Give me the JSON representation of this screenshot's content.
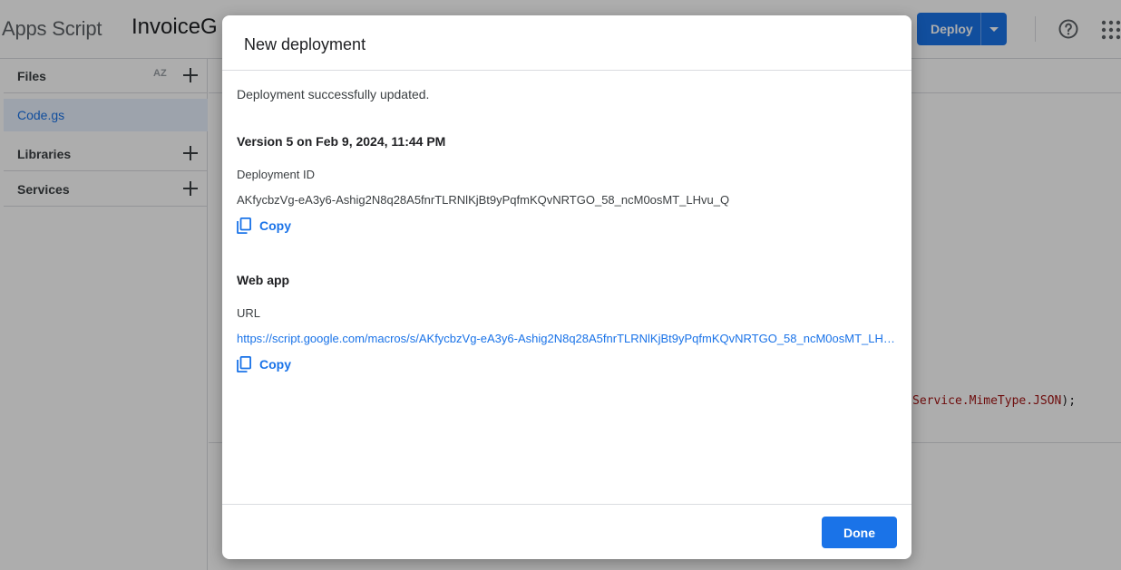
{
  "app": {
    "title": "Apps Script",
    "project_name": "InvoiceG",
    "deploy_label": "Deploy"
  },
  "sidebar": {
    "files_label": "Files",
    "sort_icon_text": "AZ",
    "files": [
      {
        "name": "Code.gs"
      }
    ],
    "libraries_label": "Libraries",
    "services_label": "Services"
  },
  "editor": {
    "visible_code": "Service.MimeType.JSON",
    "visible_code_end": ");"
  },
  "dialog": {
    "title": "New deployment",
    "status": "Deployment successfully updated.",
    "version_line": "Version 5 on Feb 9, 2024, 11:44 PM",
    "deployment_id_label": "Deployment ID",
    "deployment_id": "AKfycbzVg-eA3y6-Ashig2N8q28A5fnrTLRNlKjBt9yPqfmKQvNRTGO_58_ncM0osMT_LHvu_Q",
    "copy_label": "Copy",
    "web_app_title": "Web app",
    "url_label": "URL",
    "url": "https://script.google.com/macros/s/AKfycbzVg-eA3y6-Ashig2N8q28A5fnrTLRNlKjBt9yPqfmKQvNRTGO_58_ncM0osMT_LHvu_Q/exec",
    "done_label": "Done"
  },
  "colors": {
    "accent": "#1a73e8",
    "selected_bg": "#e8f0fe",
    "scrim": "rgba(0,0,0,0.32)"
  },
  "icons": {
    "help": "help-circle-icon",
    "apps": "apps-grid-icon",
    "copy": "copy-icon",
    "add": "plus-icon",
    "sort": "sort-az-icon",
    "dropdown": "caret-down-icon"
  }
}
